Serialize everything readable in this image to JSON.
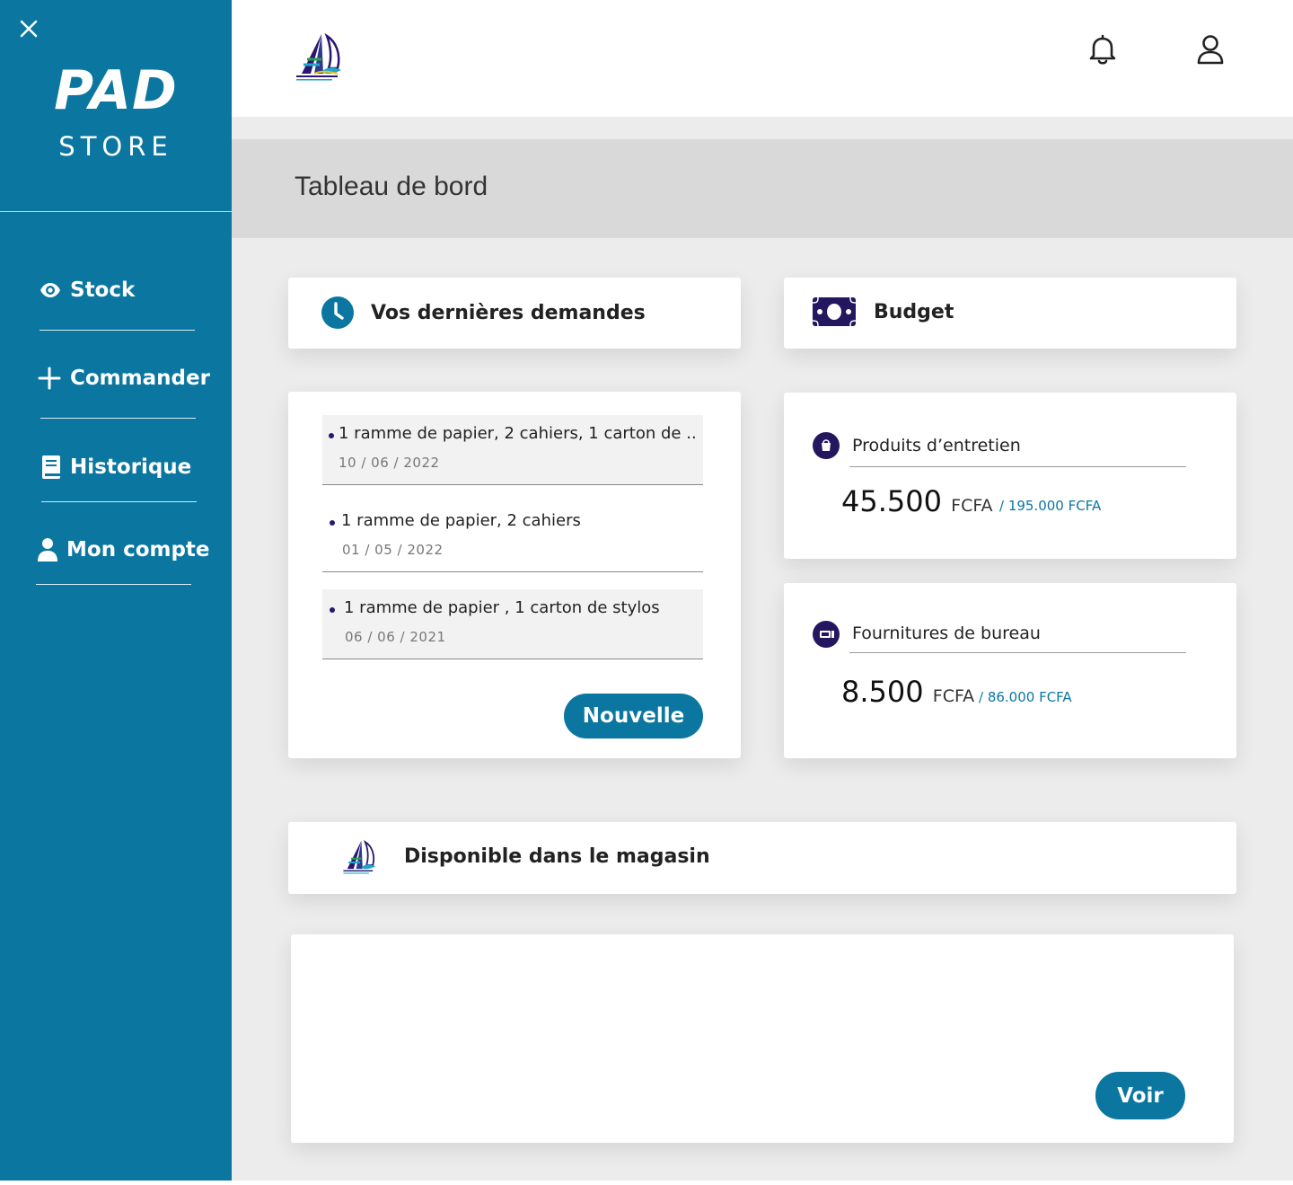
{
  "sidebar": {
    "brand_top": "PAD",
    "brand_bottom": "STORE",
    "items": [
      {
        "label": "Stock",
        "icon": "eye-icon"
      },
      {
        "label": "Commander",
        "icon": "plus-icon"
      },
      {
        "label": "Historique",
        "icon": "book-icon"
      },
      {
        "label": "Mon compte",
        "icon": "user-icon"
      }
    ]
  },
  "header": {
    "icons": [
      "bell-icon",
      "user-icon"
    ]
  },
  "page": {
    "title": "Tableau de bord"
  },
  "requests": {
    "title": "Vos dernières demandes",
    "items": [
      {
        "text": "1 ramme de papier, 2 cahiers, 1 carton de ...",
        "date": "10 / 06 / 2022"
      },
      {
        "text": "1 ramme de papier, 2 cahiers",
        "date": "01 / 05 / 2022"
      },
      {
        "text": "1 ramme de papier , 1 carton de stylos",
        "date": "06 / 06 / 2021"
      }
    ],
    "button": "Nouvelle"
  },
  "budget": {
    "title": "Budget",
    "items": [
      {
        "label": "Produits d’entretien",
        "amount": "45.500",
        "currency": "FCFA",
        "total": "/ 195.000 FCFA"
      },
      {
        "label": "Fournitures de bureau",
        "amount": "8.500",
        "currency": "FCFA",
        "total": "/ 86.000 FCFA"
      }
    ]
  },
  "store": {
    "title": "Disponible dans le magasin",
    "button": "Voir"
  },
  "colors": {
    "primary": "#0b76a0",
    "dark_purple": "#24165f",
    "background": "#ececec",
    "title_band": "#d9d9d9"
  }
}
